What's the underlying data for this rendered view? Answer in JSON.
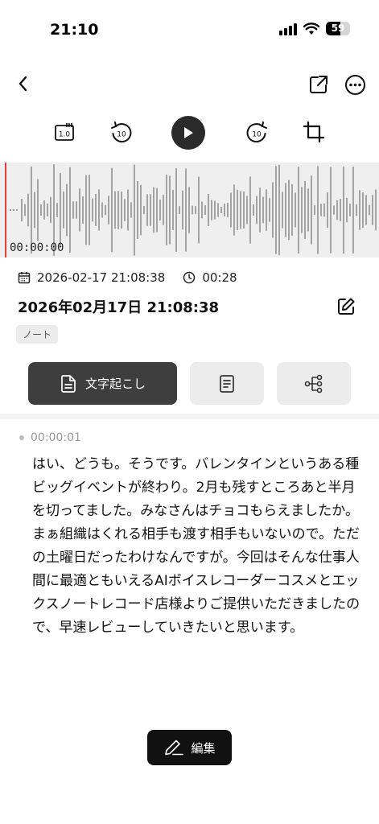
{
  "status_bar": {
    "time": "21:10",
    "battery_percent": "59",
    "battery_level": 0.59,
    "signal_icon": "cellular-signal-icon",
    "wifi_icon": "wifi-icon"
  },
  "nav": {
    "back_icon": "chevron-left-icon",
    "share_icon": "share-icon",
    "more_icon": "more-horizontal-icon"
  },
  "player": {
    "speed_label": "1.0",
    "rewind_label": "10",
    "forward_label": "10",
    "play_icon": "play-icon",
    "crop_icon": "crop-icon",
    "current_time": "00:00:00"
  },
  "recording": {
    "date": "2026-02-17 21:08:38",
    "duration": "00:28",
    "title": "2026年02月17日 21:08:38",
    "tag": "ノート"
  },
  "tabs": {
    "transcript_label": "文字起こし",
    "summary_icon": "document-lines-icon",
    "mindmap_icon": "mindmap-icon"
  },
  "transcript": {
    "timestamp": "00:00:01",
    "text": "はい、どうも。そうです。バレンタインというある種ビッグイベントが終わり。2月も残すところあと半月を切ってました。みなさんはチョコもらえましたか。まぁ組織はくれる相手も渡す相手もいないので。ただの土曜日だったわけなんですが。今回はそんな仕事人間に最適ともいえるAIボイスレコーダーコスメとエックスノートレコード店様よりご提供いただきましたので、早速レビューしていきたいと思います。"
  },
  "edit": {
    "label": "編集"
  },
  "colors": {
    "accent_dark": "#3e3e3e",
    "playhead": "#e23b3b",
    "waveform_bg": "#efefef"
  }
}
